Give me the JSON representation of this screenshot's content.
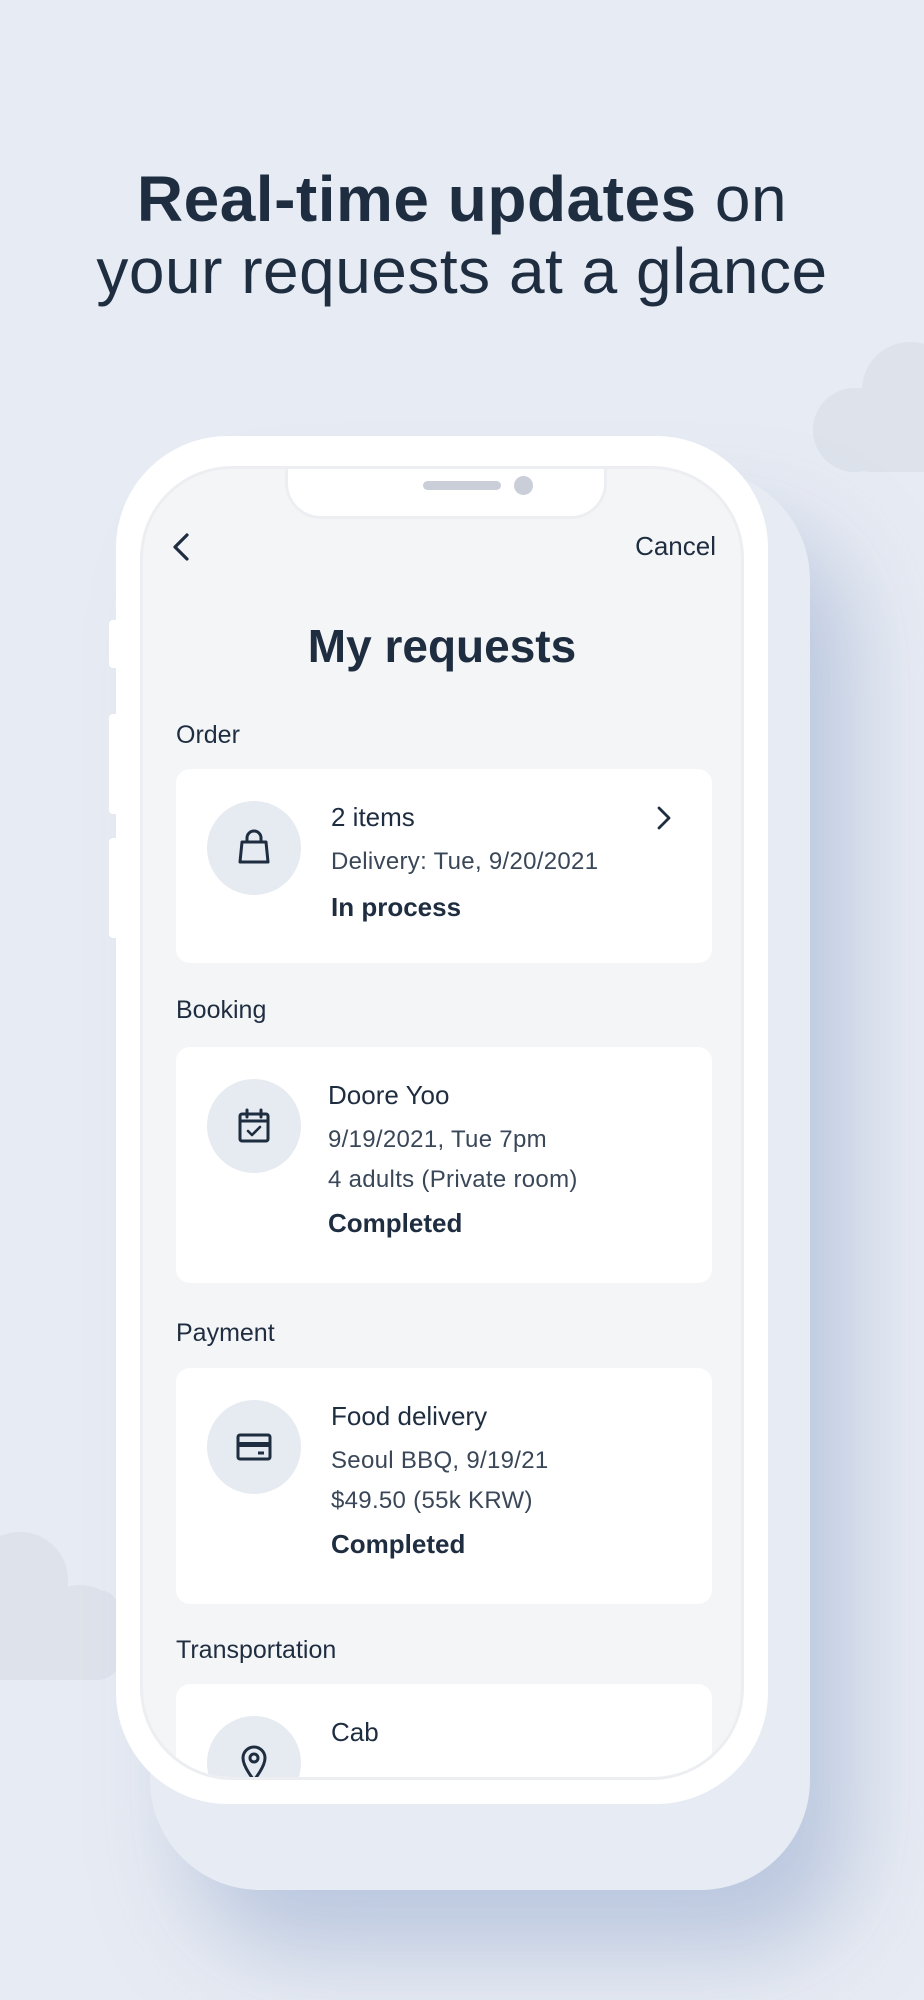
{
  "headline": {
    "bold": "Real-time updates",
    "rest1": " on",
    "line2": "your requests at a glance"
  },
  "nav": {
    "back_icon": "chevron-left-icon",
    "cancel_label": "Cancel"
  },
  "page_title": "My requests",
  "sections": {
    "order": {
      "label": "Order",
      "icon": "shopping-bag-icon",
      "title": "2 items",
      "line1": "Delivery: Tue, 9/20/2021",
      "status": "In process"
    },
    "booking": {
      "label": "Booking",
      "icon": "calendar-check-icon",
      "title": "Doore Yoo",
      "line1": "9/19/2021, Tue 7pm",
      "line2": "4 adults (Private room)",
      "status": "Completed"
    },
    "payment": {
      "label": "Payment",
      "icon": "credit-card-icon",
      "title": "Food delivery",
      "line1": "Seoul BBQ, 9/19/21",
      "line2": "$49.50 (55k KRW)",
      "status": "Completed"
    },
    "transportation": {
      "label": "Transportation",
      "icon": "map-pin-icon",
      "title": "Cab"
    }
  }
}
